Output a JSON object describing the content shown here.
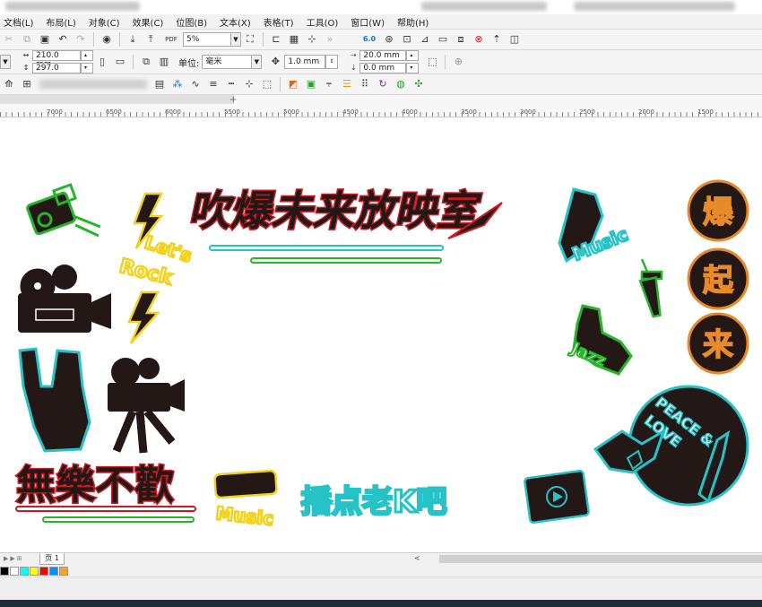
{
  "menu": {
    "items": [
      "文档(L)",
      "布局(L)",
      "对象(C)",
      "效果(C)",
      "位图(B)",
      "文本(X)",
      "表格(T)",
      "工具(O)",
      "窗口(W)",
      "帮助(H)"
    ]
  },
  "toolbar1": {
    "zoom_value": "5%",
    "pdf_label": "PDF",
    "xcut_label": "6.0"
  },
  "toolbar2": {
    "width_value": "210.0 mm",
    "height_value": "297.0 mm",
    "units_label": "单位:",
    "units_value": "毫米",
    "nudge_value": "1.0 mm",
    "dup_x_value": "20.0 mm",
    "dup_y_value": "0.0 mm"
  },
  "ruler": {
    "labels": [
      "7000",
      "6500",
      "6000",
      "5500",
      "5000",
      "4500",
      "4000",
      "3500",
      "3000",
      "2500",
      "2000",
      "1500"
    ]
  },
  "canvas": {
    "title_text": "吹爆未来放映室",
    "lets_rock": [
      "Let's",
      "Rock"
    ],
    "music_label": "Music",
    "music_label_2": "Music",
    "wuyuebuhuan": "無樂不歡",
    "bo_shen_me": "播点老K吧",
    "circle_chars": [
      "爆",
      "起",
      "来"
    ],
    "peace_love": [
      "PEACE &",
      "LOVE"
    ],
    "jazz_label": "Jazz",
    "colors": {
      "red": "#cc1a24",
      "green": "#27b52a",
      "cyan": "#25c3c8",
      "yellow": "#f2d21a",
      "orange": "#e8892a",
      "dark": "#231816"
    }
  },
  "pagebar": {
    "page_tab": "页 1"
  },
  "palette": {
    "swatches": [
      "#000000",
      "#ffffff",
      "#00ffff",
      "#ffff00",
      "#ff0000",
      "#0090ff",
      "#f7a12a"
    ]
  }
}
